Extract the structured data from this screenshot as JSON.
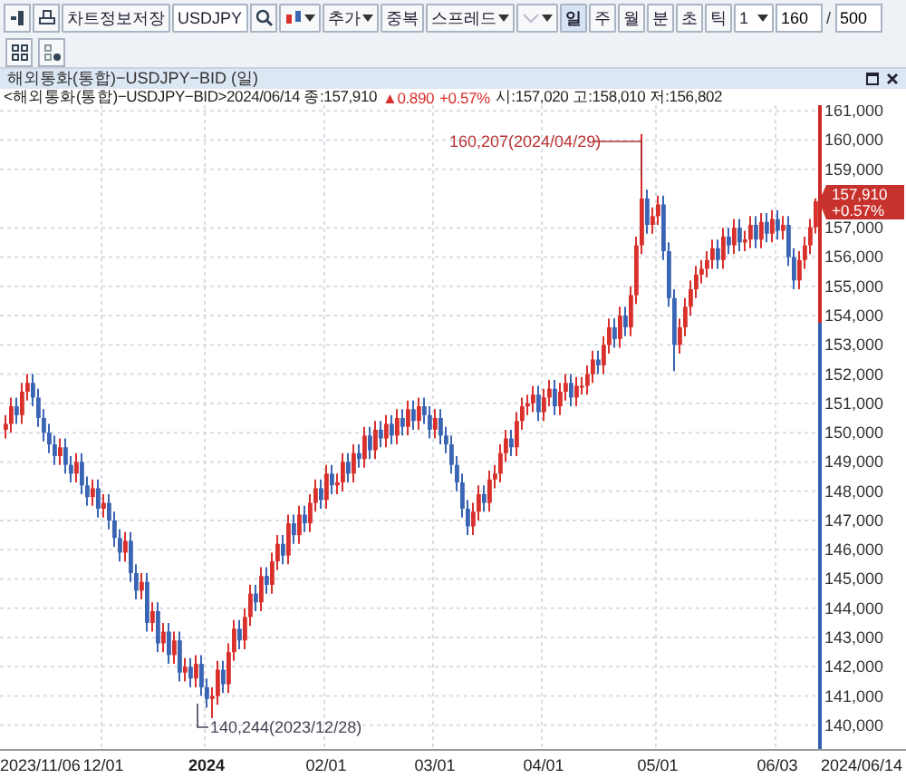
{
  "toolbar": {
    "save_label": "차트정보저장",
    "symbol": "USDJPY",
    "add_label": "추가",
    "overlap_label": "중복",
    "spread_label": "스프레드",
    "periods": [
      {
        "label": "일",
        "selected": true
      },
      {
        "label": "주",
        "selected": false
      },
      {
        "label": "월",
        "selected": false
      },
      {
        "label": "분",
        "selected": false
      },
      {
        "label": "초",
        "selected": false
      },
      {
        "label": "틱",
        "selected": false
      }
    ],
    "interval": "1",
    "count": "160",
    "separator": "/",
    "total": "500"
  },
  "window": {
    "title": "해외통화(통합)−USDJPY−BID (일)"
  },
  "info": {
    "label": "<해외통화(통합)−USDJPY−BID>2024/06/14 종:157,910",
    "change": "▲0.890",
    "change_pct": "+0.57%",
    "ohl": "시:157,020 고:158,010 저:156,802"
  },
  "chart": {
    "start_date": "2023/11/06",
    "end_date": "2024/06/14",
    "high_note": "160,207(2024/04/29)",
    "low_note": "140,244(2023/12/28)",
    "last_price": "157,910",
    "last_change": "+0.57%",
    "chart_data": {
      "type": "candlestick",
      "grid": true,
      "ylim": [
        139190,
        161190
      ],
      "yticks": [
        {
          "value": 161000,
          "label": "161,000"
        },
        {
          "value": 160000,
          "label": "160,000"
        },
        {
          "value": 159000,
          "label": "159,000"
        },
        {
          "value": 157000,
          "label": "157,000"
        },
        {
          "value": 156000,
          "label": "156,000"
        },
        {
          "value": 155000,
          "label": "155,000"
        },
        {
          "value": 154000,
          "label": "154,000"
        },
        {
          "value": 153000,
          "label": "153,000"
        },
        {
          "value": 152000,
          "label": "152,000"
        },
        {
          "value": 151000,
          "label": "151,000"
        },
        {
          "value": 150000,
          "label": "150,000"
        },
        {
          "value": 149000,
          "label": "149,000"
        },
        {
          "value": 148000,
          "label": "148,000"
        },
        {
          "value": 147000,
          "label": "147,000"
        },
        {
          "value": 146000,
          "label": "146,000"
        },
        {
          "value": 145000,
          "label": "145,000"
        },
        {
          "value": 144000,
          "label": "144,000"
        },
        {
          "value": 143000,
          "label": "143,000"
        },
        {
          "value": 142000,
          "label": "142,000"
        },
        {
          "value": 141000,
          "label": "141,000"
        },
        {
          "value": 140000,
          "label": "140,000"
        }
      ],
      "categories": [
        null,
        null,
        null,
        null,
        null,
        null,
        null,
        null,
        null,
        null,
        null,
        null,
        null,
        null,
        null,
        null,
        null,
        null,
        "12/01",
        null,
        null,
        null,
        null,
        null,
        null,
        null,
        null,
        null,
        null,
        null,
        null,
        null,
        null,
        null,
        null,
        null,
        null,
        "2024",
        null,
        null,
        null,
        null,
        null,
        null,
        null,
        null,
        null,
        null,
        null,
        null,
        null,
        null,
        null,
        null,
        null,
        null,
        null,
        null,
        null,
        "02/01",
        null,
        null,
        null,
        null,
        null,
        null,
        null,
        null,
        null,
        null,
        null,
        null,
        null,
        null,
        null,
        null,
        null,
        null,
        null,
        "03/01",
        null,
        null,
        null,
        null,
        null,
        null,
        null,
        null,
        null,
        null,
        null,
        null,
        null,
        null,
        null,
        null,
        null,
        null,
        null,
        "04/01",
        null,
        null,
        null,
        null,
        null,
        null,
        null,
        null,
        null,
        null,
        null,
        null,
        null,
        null,
        null,
        null,
        null,
        null,
        null,
        null,
        "05/01",
        null,
        null,
        null,
        null,
        null,
        null,
        null,
        null,
        null,
        null,
        null,
        null,
        null,
        null,
        null,
        null,
        null,
        null,
        null,
        null,
        null,
        "06/03",
        null,
        null,
        null,
        null,
        null,
        null,
        null
      ],
      "ohlc": [
        [
          150100,
          150600,
          149800,
          150300
        ],
        [
          150300,
          151200,
          150000,
          150900
        ],
        [
          150900,
          151200,
          150300,
          150600
        ],
        [
          150600,
          151700,
          150300,
          151400
        ],
        [
          151400,
          152000,
          151100,
          151700
        ],
        [
          151700,
          152000,
          150900,
          151200
        ],
        [
          151200,
          151500,
          150200,
          150500
        ],
        [
          150500,
          150800,
          149700,
          150000
        ],
        [
          150000,
          150300,
          149300,
          149600
        ],
        [
          149600,
          149900,
          148900,
          149200
        ],
        [
          149200,
          149800,
          148900,
          149500
        ],
        [
          149500,
          149800,
          148600,
          148900
        ],
        [
          148900,
          149200,
          148300,
          148600
        ],
        [
          148600,
          149300,
          148300,
          149000
        ],
        [
          149000,
          149300,
          147900,
          148200
        ],
        [
          148200,
          148500,
          147500,
          147800
        ],
        [
          147800,
          148400,
          147500,
          148100
        ],
        [
          148100,
          148400,
          147100,
          147400
        ],
        [
          147400,
          147900,
          147100,
          147600
        ],
        [
          147600,
          147900,
          146700,
          147000
        ],
        [
          147000,
          147300,
          146100,
          146400
        ],
        [
          146400,
          146700,
          145600,
          145900
        ],
        [
          145900,
          146600,
          145600,
          146300
        ],
        [
          146300,
          146600,
          144900,
          145200
        ],
        [
          145200,
          145500,
          144300,
          144600
        ],
        [
          144600,
          145200,
          144300,
          144900
        ],
        [
          144900,
          145200,
          143200,
          143500
        ],
        [
          143500,
          144200,
          143200,
          143900
        ],
        [
          143900,
          144200,
          142500,
          142800
        ],
        [
          142800,
          143500,
          142500,
          143200
        ],
        [
          143200,
          143500,
          142100,
          142400
        ],
        [
          142400,
          143200,
          142100,
          142900
        ],
        [
          142900,
          143200,
          141500,
          141800
        ],
        [
          141800,
          142300,
          141500,
          142000
        ],
        [
          142000,
          142300,
          141300,
          141600
        ],
        [
          141600,
          142400,
          141300,
          142100
        ],
        [
          142100,
          142400,
          141000,
          141300
        ],
        [
          141300,
          141600,
          140600,
          140900
        ],
        [
          140900,
          141300,
          140244,
          141000
        ],
        [
          141000,
          142200,
          140700,
          141900
        ],
        [
          141900,
          142200,
          141100,
          141400
        ],
        [
          141400,
          142800,
          141100,
          142500
        ],
        [
          142500,
          143600,
          142200,
          143300
        ],
        [
          143300,
          143600,
          142600,
          142900
        ],
        [
          142900,
          144000,
          142600,
          143700
        ],
        [
          143700,
          144800,
          143400,
          144500
        ],
        [
          144500,
          144800,
          143900,
          144200
        ],
        [
          144200,
          145400,
          143900,
          145100
        ],
        [
          145100,
          145400,
          144500,
          144800
        ],
        [
          144800,
          145900,
          144500,
          145600
        ],
        [
          145600,
          146500,
          145300,
          146200
        ],
        [
          146200,
          146500,
          145500,
          145800
        ],
        [
          145800,
          147200,
          145500,
          146900
        ],
        [
          146900,
          147200,
          146200,
          146500
        ],
        [
          146500,
          147500,
          146200,
          147200
        ],
        [
          147200,
          147500,
          146600,
          146900
        ],
        [
          146900,
          147900,
          146600,
          147600
        ],
        [
          147600,
          148400,
          147300,
          148100
        ],
        [
          148100,
          148400,
          147400,
          147700
        ],
        [
          147700,
          148900,
          147400,
          148600
        ],
        [
          148600,
          148900,
          147900,
          148200
        ],
        [
          148200,
          148600,
          147900,
          148300
        ],
        [
          148300,
          149300,
          148000,
          149000
        ],
        [
          149000,
          149300,
          148300,
          148600
        ],
        [
          148600,
          149600,
          148300,
          149300
        ],
        [
          149300,
          149600,
          148800,
          149100
        ],
        [
          149100,
          150200,
          148800,
          149900
        ],
        [
          149900,
          150200,
          149100,
          149400
        ],
        [
          149400,
          150400,
          149100,
          150100
        ],
        [
          150100,
          150400,
          149500,
          149800
        ],
        [
          149800,
          150600,
          149500,
          150300
        ],
        [
          150300,
          150600,
          149600,
          149900
        ],
        [
          149900,
          150800,
          149600,
          150500
        ],
        [
          150500,
          150800,
          149900,
          150200
        ],
        [
          150200,
          151100,
          149900,
          150800
        ],
        [
          150800,
          151100,
          150100,
          150400
        ],
        [
          150400,
          151200,
          150100,
          150900
        ],
        [
          150900,
          151200,
          150300,
          150600
        ],
        [
          150600,
          150900,
          149800,
          150100
        ],
        [
          150100,
          150800,
          149800,
          150500
        ],
        [
          150500,
          150800,
          149600,
          149900
        ],
        [
          149900,
          150200,
          149300,
          149600
        ],
        [
          149600,
          149900,
          148600,
          148900
        ],
        [
          148900,
          149200,
          148000,
          148300
        ],
        [
          148300,
          148600,
          147100,
          147400
        ],
        [
          147400,
          147700,
          146500,
          146800
        ],
        [
          146800,
          147600,
          146500,
          147300
        ],
        [
          147300,
          148200,
          147000,
          147900
        ],
        [
          147900,
          148200,
          147300,
          147600
        ],
        [
          147600,
          148700,
          147300,
          148400
        ],
        [
          148400,
          148900,
          148100,
          148600
        ],
        [
          148600,
          149600,
          148300,
          149300
        ],
        [
          149300,
          150100,
          149000,
          149800
        ],
        [
          149800,
          150100,
          149200,
          149500
        ],
        [
          149500,
          150700,
          149200,
          150400
        ],
        [
          150400,
          151200,
          150100,
          150900
        ],
        [
          150900,
          151300,
          150600,
          151000
        ],
        [
          151000,
          151600,
          150700,
          151300
        ],
        [
          151300,
          151600,
          150400,
          150700
        ],
        [
          150700,
          151500,
          150400,
          151200
        ],
        [
          151200,
          151800,
          150900,
          151500
        ],
        [
          151500,
          151800,
          150600,
          150900
        ],
        [
          150900,
          151700,
          150600,
          151400
        ],
        [
          151400,
          152000,
          151100,
          151700
        ],
        [
          151700,
          152000,
          150900,
          151200
        ],
        [
          151200,
          151900,
          150900,
          151600
        ],
        [
          151600,
          151900,
          151300,
          151600
        ],
        [
          151600,
          152300,
          151300,
          152000
        ],
        [
          152000,
          152800,
          151700,
          152500
        ],
        [
          152500,
          152800,
          152000,
          152300
        ],
        [
          152300,
          153300,
          152000,
          153000
        ],
        [
          153000,
          153900,
          152700,
          153600
        ],
        [
          153600,
          153900,
          152900,
          153200
        ],
        [
          153200,
          154300,
          152900,
          154000
        ],
        [
          154000,
          154300,
          153300,
          153600
        ],
        [
          153600,
          155000,
          153300,
          154700
        ],
        [
          154700,
          156700,
          154400,
          156400
        ],
        [
          156400,
          160207,
          156100,
          158000
        ],
        [
          158000,
          158300,
          156800,
          157100
        ],
        [
          157100,
          157700,
          156800,
          157400
        ],
        [
          157400,
          158100,
          157100,
          157800
        ],
        [
          157800,
          158100,
          155900,
          156200
        ],
        [
          156200,
          156500,
          154300,
          154600
        ],
        [
          154600,
          154900,
          152100,
          153000
        ],
        [
          153000,
          153900,
          152700,
          153600
        ],
        [
          153600,
          154600,
          153300,
          154300
        ],
        [
          154300,
          155200,
          154000,
          154900
        ],
        [
          154900,
          155700,
          154600,
          155400
        ],
        [
          155400,
          155900,
          155100,
          155600
        ],
        [
          155600,
          156200,
          155300,
          155900
        ],
        [
          155900,
          156600,
          155600,
          156300
        ],
        [
          156300,
          156600,
          155600,
          155900
        ],
        [
          155900,
          157000,
          155600,
          156700
        ],
        [
          156700,
          157000,
          156100,
          156400
        ],
        [
          156400,
          157300,
          156100,
          157000
        ],
        [
          157000,
          157300,
          156200,
          156500
        ],
        [
          156500,
          156900,
          156200,
          156600
        ],
        [
          156600,
          157400,
          156300,
          157100
        ],
        [
          157100,
          157400,
          156300,
          156600
        ],
        [
          156600,
          157500,
          156300,
          157200
        ],
        [
          157200,
          157500,
          156500,
          156800
        ],
        [
          156800,
          157600,
          156500,
          157300
        ],
        [
          157300,
          157600,
          156600,
          156900
        ],
        [
          156900,
          157400,
          156600,
          157100
        ],
        [
          157100,
          157400,
          155700,
          156000
        ],
        [
          156000,
          156300,
          154900,
          155200
        ],
        [
          155200,
          156200,
          154900,
          155900
        ],
        [
          155900,
          156700,
          155600,
          156400
        ],
        [
          156400,
          157300,
          156100,
          157020
        ],
        [
          157020,
          158010,
          156802,
          157910
        ]
      ]
    }
  }
}
